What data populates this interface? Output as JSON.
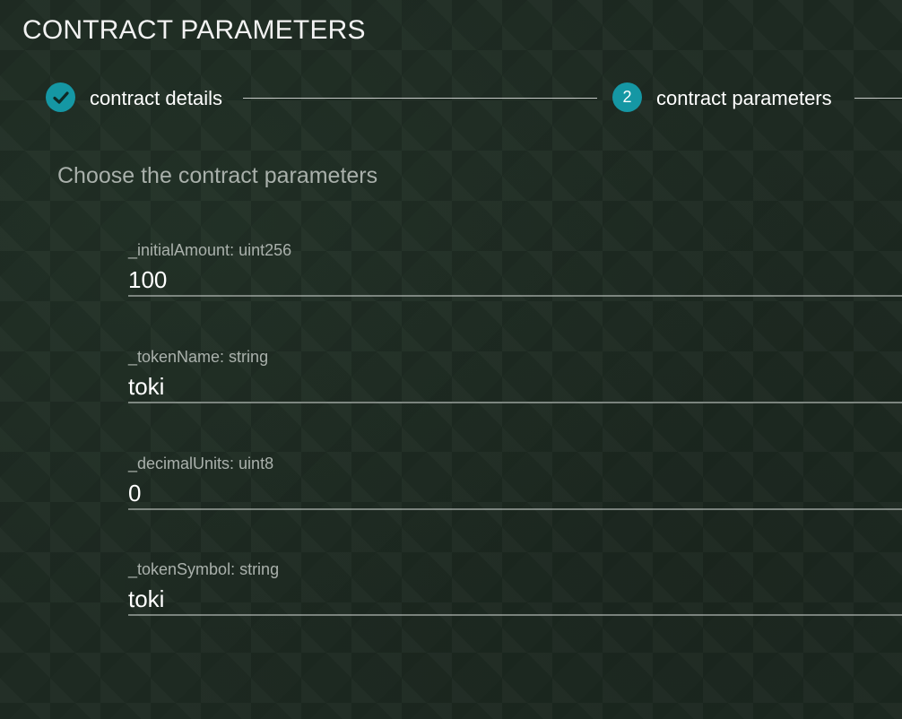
{
  "page": {
    "title": "CONTRACT PARAMETERS",
    "subtitle": "Choose the contract parameters"
  },
  "stepper": {
    "steps": [
      {
        "label": "contract details",
        "state": "completed",
        "icon": "check-icon"
      },
      {
        "label": "contract parameters",
        "state": "active",
        "number": "2"
      }
    ],
    "accent_color": "#1597a4"
  },
  "fields": [
    {
      "label": "_initialAmount: uint256",
      "value": "100"
    },
    {
      "label": "_tokenName: string",
      "value": "toki"
    },
    {
      "label": "_decimalUnits: uint8",
      "value": "0"
    },
    {
      "label": "_tokenSymbol: string",
      "value": "toki"
    }
  ]
}
